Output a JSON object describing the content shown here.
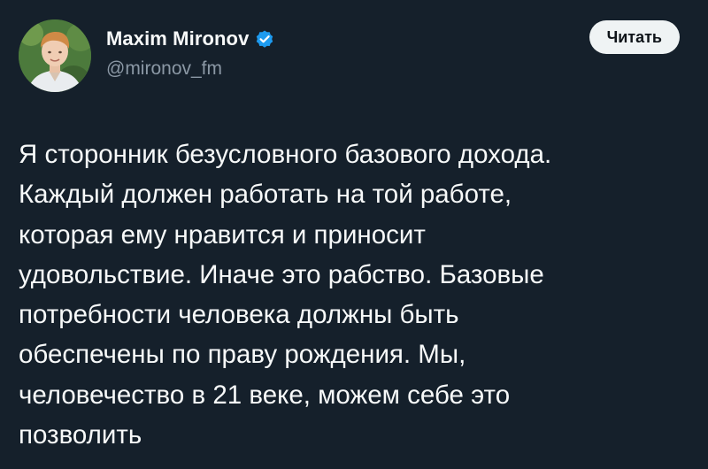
{
  "author": {
    "display_name": "Maxim Mironov",
    "handle": "@mironov_fm",
    "verified": true,
    "avatar_icon": "user-avatar-photo",
    "verified_icon": "verified-badge-icon"
  },
  "actions": {
    "follow_label": "Читать"
  },
  "tweet": {
    "lines": [
      "Я сторонник безусловного базового дохода.",
      "Каждый должен работать на той работе,",
      "которая ему нравится и приносит",
      "удовольствие. Иначе это рабство. Базовые",
      "потребности человека должны быть",
      "обеспечены по праву рождения. Мы,",
      "человечество в 21 веке, можем себе это",
      "позволить"
    ]
  },
  "colors": {
    "background": "#15202b",
    "text": "#f7f9f9",
    "secondary_text": "#8b98a5",
    "verified_blue": "#1d9bf0",
    "button_bg": "#eff3f4",
    "button_text": "#0f1419"
  }
}
